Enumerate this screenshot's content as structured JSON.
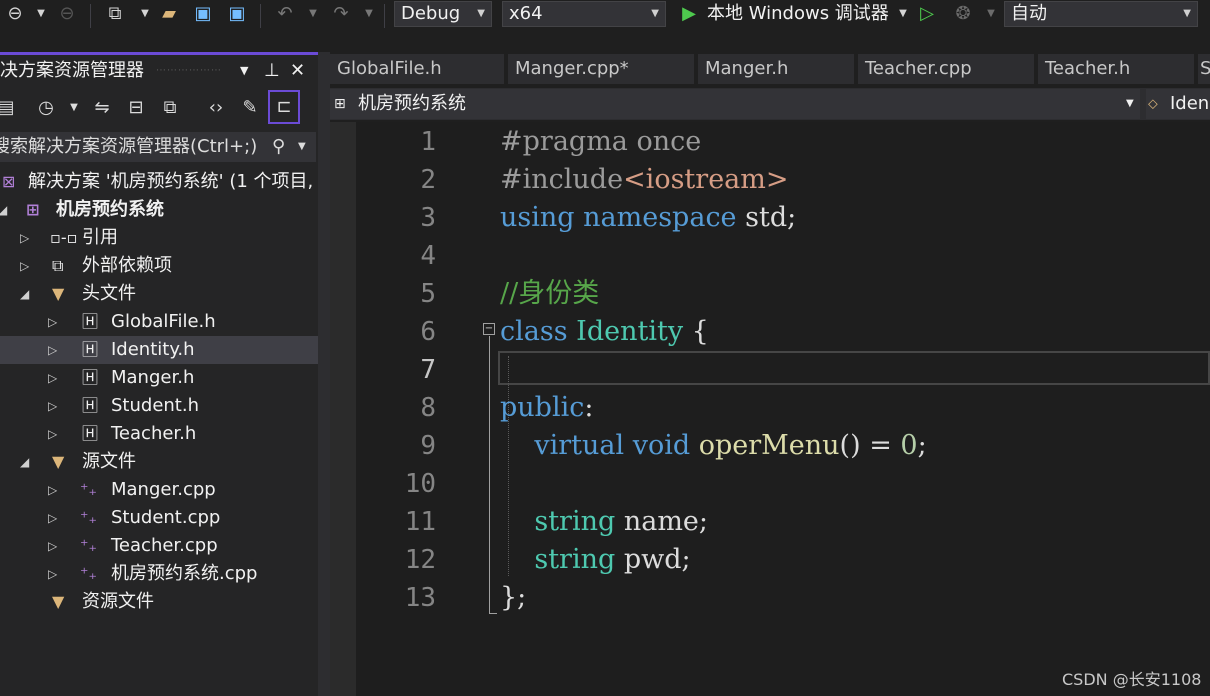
{
  "toolbar": {
    "config": "Debug",
    "platform": "x64",
    "run_label": "本地 Windows 调试器",
    "auto": "自动"
  },
  "solution_explorer": {
    "title": "决方案资源管理器",
    "search_placeholder": "搜索解决方案资源管理器(Ctrl+;)",
    "solution": "解决方案 '机房预约系统' (1 个项目,",
    "project": "机房预约系统",
    "references": "引用",
    "external": "外部依赖项",
    "headers_folder": "头文件",
    "headers": [
      "GlobalFile.h",
      "Identity.h",
      "Manger.h",
      "Student.h",
      "Teacher.h"
    ],
    "sources_folder": "源文件",
    "sources": [
      "Manger.cpp",
      "Student.cpp",
      "Teacher.cpp",
      "机房预约系统.cpp"
    ],
    "resources_folder": "资源文件"
  },
  "tabs": [
    "GlobalFile.h",
    "Manger.cpp*",
    "Manger.h",
    "Teacher.cpp",
    "Teacher.h",
    "S"
  ],
  "nav": {
    "project": "机房预约系统",
    "scope": "Iden"
  },
  "editor": {
    "line_numbers": [
      "1",
      "2",
      "3",
      "4",
      "5",
      "6",
      "7",
      "8",
      "9",
      "10",
      "11",
      "12",
      "13"
    ],
    "current_line": 7
  },
  "watermark": "CSDN @长安1108"
}
